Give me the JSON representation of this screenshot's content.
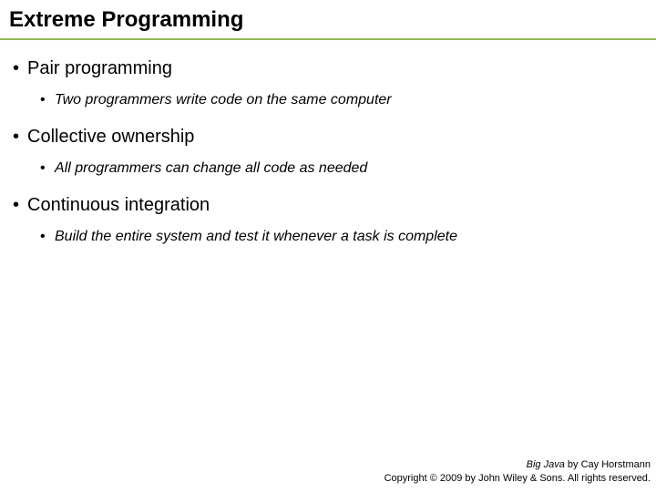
{
  "title": "Extreme Programming",
  "bullets": [
    {
      "text": "Pair programming",
      "sub": "Two programmers write code on the same computer"
    },
    {
      "text": "Collective ownership",
      "sub": "All programmers can change all code as needed"
    },
    {
      "text": "Continuous integration",
      "sub": "Build the entire system and test it whenever a task is complete"
    }
  ],
  "footer": {
    "book_title": "Big Java",
    "byline": " by Cay Horstmann",
    "copyright": "Copyright © 2009 by John Wiley & Sons.  All rights reserved."
  }
}
